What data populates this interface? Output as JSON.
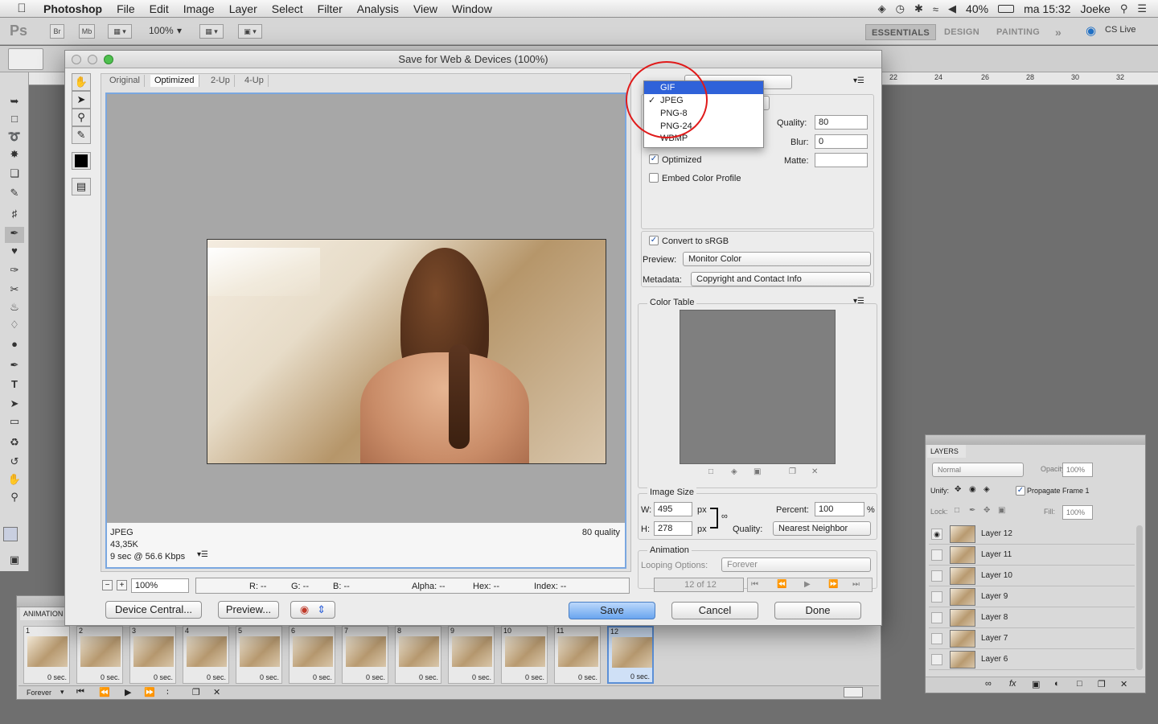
{
  "menubar": {
    "app": "Photoshop",
    "items": [
      "File",
      "Edit",
      "Image",
      "Layer",
      "Select",
      "Filter",
      "Analysis",
      "View",
      "Window"
    ],
    "battery": "40%",
    "clock": "ma 15:32",
    "user": "Joeke"
  },
  "options_bar": {
    "logo": "Ps",
    "bridge": "Br",
    "minibridge": "Mb",
    "zoom": "100%",
    "workspaces": [
      "ESSENTIALS",
      "DESIGN",
      "PAINTING"
    ],
    "cs_live": "CS Live"
  },
  "ruler": [
    "22",
    "24",
    "26",
    "28",
    "30",
    "32"
  ],
  "dialog": {
    "title": "Save for Web & Devices (100%)",
    "tabs": [
      "Original",
      "Optimized",
      "2-Up",
      "4-Up"
    ],
    "info": {
      "format": "JPEG",
      "size": "43,35K",
      "speed": "9 sec @ 56.6 Kbps",
      "quality": "80 quality"
    },
    "zoom": "100%",
    "readouts": {
      "r": "R: --",
      "g": "G: --",
      "b": "B: --",
      "alpha": "Alpha: --",
      "hex": "Hex: --",
      "index": "Index: --"
    },
    "buttons": {
      "device_central": "Device Central...",
      "preview": "Preview...",
      "save": "Save",
      "cancel": "Cancel",
      "done": "Done"
    },
    "settings": {
      "format_options": [
        "GIF",
        "JPEG",
        "PNG-8",
        "PNG-24",
        "WBMP"
      ],
      "format_highlighted": "GIF",
      "format_checked": "JPEG",
      "quality_label": "Quality:",
      "quality": "80",
      "blur_label": "Blur:",
      "blur": "0",
      "matte_label": "Matte:",
      "optimized": "Optimized",
      "embed_profile": "Embed Color Profile",
      "convert_srgb": "Convert to sRGB",
      "preview_label": "Preview:",
      "preview_value": "Monitor Color",
      "metadata_label": "Metadata:",
      "metadata_value": "Copyright and Contact Info",
      "color_table": "Color Table",
      "image_size": "Image Size",
      "w_label": "W:",
      "w": "495",
      "h_label": "H:",
      "h": "278",
      "px": "px",
      "percent_label": "Percent:",
      "percent": "100",
      "percent_unit": "%",
      "resample_label": "Quality:",
      "resample_value": "Nearest Neighbor",
      "animation": "Animation",
      "looping_label": "Looping Options:",
      "looping_value": "Forever",
      "frame_counter": "12 of 12"
    }
  },
  "animation_panel": {
    "title": "ANIMATION",
    "loop": "Forever",
    "frames": [
      {
        "num": "1",
        "delay": "0 sec."
      },
      {
        "num": "2",
        "delay": "0 sec."
      },
      {
        "num": "3",
        "delay": "0 sec."
      },
      {
        "num": "4",
        "delay": "0 sec."
      },
      {
        "num": "5",
        "delay": "0 sec."
      },
      {
        "num": "6",
        "delay": "0 sec."
      },
      {
        "num": "7",
        "delay": "0 sec."
      },
      {
        "num": "8",
        "delay": "0 sec."
      },
      {
        "num": "9",
        "delay": "0 sec."
      },
      {
        "num": "10",
        "delay": "0 sec."
      },
      {
        "num": "11",
        "delay": "0 sec."
      },
      {
        "num": "12",
        "delay": "0 sec."
      }
    ]
  },
  "layers_panel": {
    "title": "LAYERS",
    "blend": "Normal",
    "opacity_label": "Opacity:",
    "opacity": "100%",
    "unify_label": "Unify:",
    "propagate": "Propagate Frame 1",
    "lock_label": "Lock:",
    "fill_label": "Fill:",
    "fill": "100%",
    "layers": [
      "Layer 12",
      "Layer 11",
      "Layer 10",
      "Layer 9",
      "Layer 8",
      "Layer 7",
      "Layer 6"
    ]
  },
  "colors": {
    "accent": "#2f62d9",
    "annotation": "#e01a1a",
    "primary_button": "#6aa5ef"
  }
}
